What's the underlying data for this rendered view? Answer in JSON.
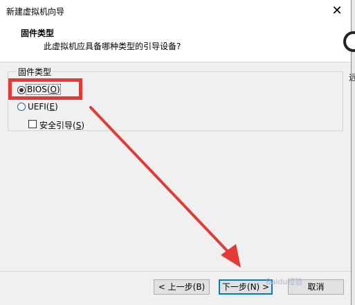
{
  "window": {
    "title": "新建虚拟机向导",
    "close_glyph": "✕"
  },
  "header": {
    "title": "固件类型",
    "description": "此虚拟机应具备哪种类型的引导设备?"
  },
  "group": {
    "label": "固件类型",
    "options": [
      {
        "label": "BIOS(",
        "mnemonic": "O",
        "suffix": ")",
        "selected": true
      },
      {
        "label": "UEFI(",
        "mnemonic": "E",
        "suffix": ")",
        "selected": false
      }
    ],
    "secure_boot": {
      "label": "安全引导(",
      "mnemonic": "S",
      "suffix": ")",
      "checked": false
    }
  },
  "buttons": {
    "back": "< 上一步(B)",
    "next": "下一步(N) >",
    "cancel": "取消"
  },
  "edge_fragment": "远",
  "watermark": "Baidu经验",
  "annotation_color": "#e53935"
}
